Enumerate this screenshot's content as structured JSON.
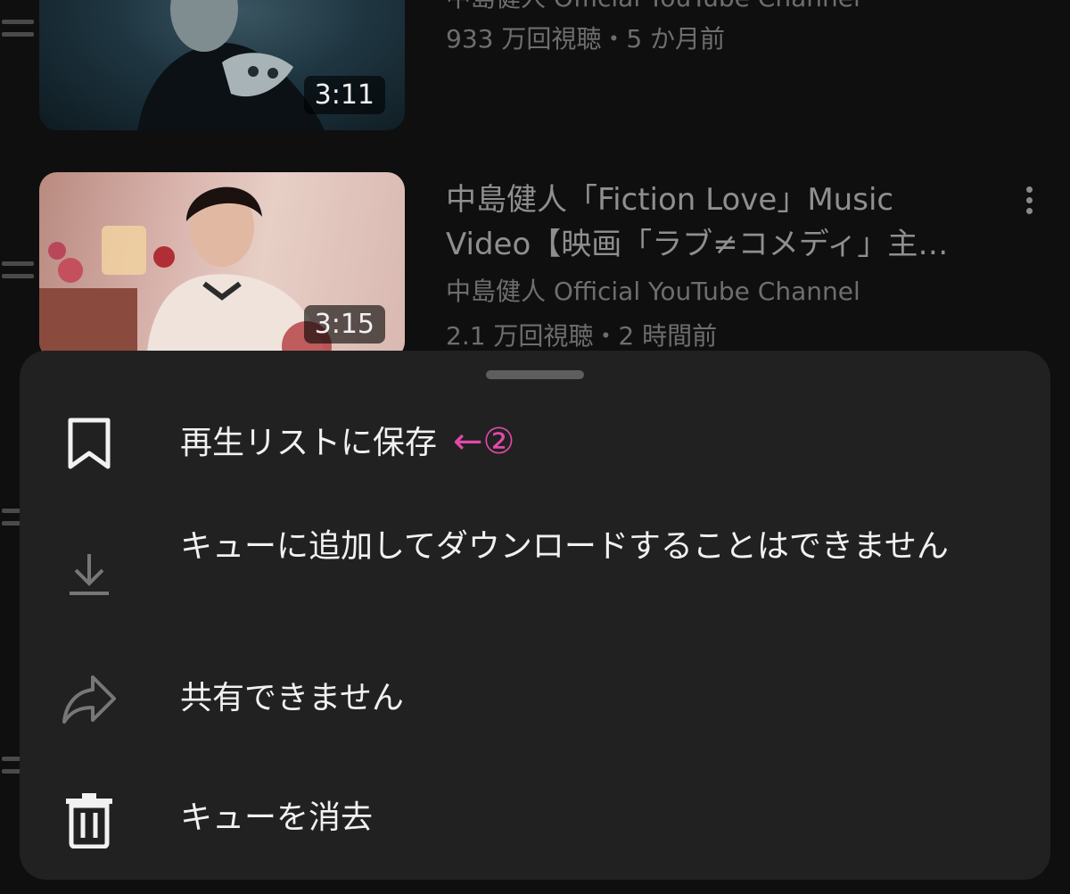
{
  "queue": {
    "items": [
      {
        "channel": "中島健人 Official YouTube Channel",
        "meta": "933 万回視聴・5 か月前",
        "duration": "3:11"
      },
      {
        "title": "中島健人「Fiction Love」Music Video【映画「ラブ≠コメディ」主…",
        "channel": "中島健人 Official YouTube Channel",
        "meta": "2.1 万回視聴・2 時間前",
        "duration": "3:15"
      }
    ]
  },
  "sheet": {
    "items": [
      {
        "label": "再生リストに保存",
        "icon": "bookmark-icon",
        "annotation": "←②",
        "enabled": true
      },
      {
        "label": "キューに追加してダウンロードすることはできません",
        "icon": "download-icon",
        "enabled": false
      },
      {
        "label": "共有できません",
        "icon": "share-icon",
        "enabled": false
      },
      {
        "label": "キューを消去",
        "icon": "trash-icon",
        "enabled": true
      }
    ]
  },
  "colors": {
    "background": "#0f0f0f",
    "sheet": "#212121",
    "annotation": "#e14aa8"
  }
}
